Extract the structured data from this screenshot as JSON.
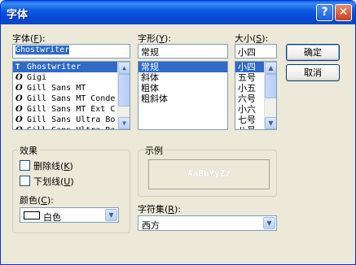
{
  "window": {
    "title": "字体",
    "help_glyph": "?",
    "close_glyph": "✕"
  },
  "font": {
    "label": "字体",
    "hotkey": "F",
    "value": "Ghostwriter",
    "items": [
      {
        "name": "Ghostwriter",
        "icon": "truetype-icon",
        "selected": true
      },
      {
        "name": "Gigi",
        "icon": "opentype-icon"
      },
      {
        "name": "Gill Sans MT",
        "icon": "opentype-icon"
      },
      {
        "name": "Gill Sans MT Conde",
        "icon": "opentype-icon"
      },
      {
        "name": "Gill Sans MT Ext C",
        "icon": "opentype-icon"
      },
      {
        "name": "Gill Sans Ultra Bo",
        "icon": "opentype-icon"
      },
      {
        "name": "Gill Sans Ultra Bo",
        "icon": "opentype-icon"
      }
    ]
  },
  "style": {
    "label": "字形",
    "hotkey": "Y",
    "value": "常规",
    "items": [
      {
        "name": "常规",
        "selected": true
      },
      {
        "name": "斜体"
      },
      {
        "name": "粗体"
      },
      {
        "name": "粗斜体"
      }
    ]
  },
  "size": {
    "label": "大小",
    "hotkey": "S",
    "value": "小四",
    "items": [
      {
        "name": "小四",
        "selected": true
      },
      {
        "name": "五号"
      },
      {
        "name": "小五"
      },
      {
        "name": "六号"
      },
      {
        "name": "小六"
      },
      {
        "name": "七号"
      },
      {
        "name": "八号"
      }
    ]
  },
  "buttons": {
    "ok": "确定",
    "cancel": "取消"
  },
  "effects": {
    "label": "效果",
    "strikeout": {
      "label": "删除线",
      "hotkey": "K"
    },
    "underline": {
      "label": "下划线",
      "hotkey": "U"
    },
    "color": {
      "label": "颜色",
      "hotkey": "C",
      "value": "白色"
    }
  },
  "sample": {
    "label": "示例",
    "text": "AaBbYyZz"
  },
  "script": {
    "label": "字符集",
    "hotkey": "R",
    "value": "西方"
  },
  "glyphs": {
    "truetype": "T",
    "opentype": "O",
    "arrow_up": "▲",
    "arrow_down": "▼",
    "combo_arrow": "▼",
    "colon_open": "(",
    "colon_close": "):"
  },
  "colors": {
    "selection": "#316ac5",
    "titlebar": "#0548d6",
    "dialog_bg": "#ece9d8"
  }
}
